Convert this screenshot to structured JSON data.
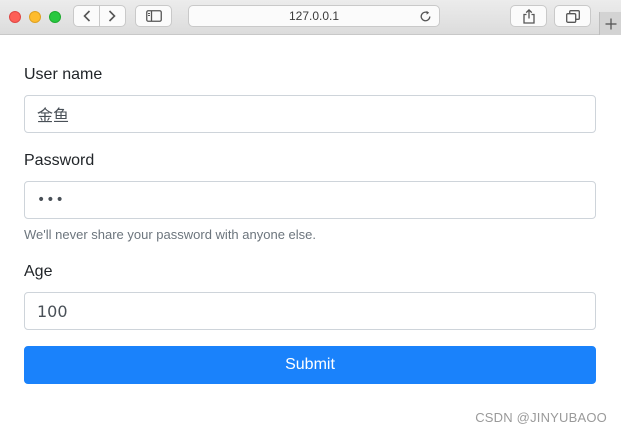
{
  "browser": {
    "address": "127.0.0.1"
  },
  "form": {
    "username_label": "User name",
    "username_value": "金鱼",
    "password_label": "Password",
    "password_value": "•••",
    "password_hint": "We'll never share your password with anyone else.",
    "age_label": "Age",
    "age_value": "100",
    "submit_label": "Submit"
  },
  "watermark": "CSDN @JINYUBAOO",
  "colors": {
    "primary": "#1a82fb",
    "border": "#ced4da",
    "hint": "#6c757d"
  }
}
